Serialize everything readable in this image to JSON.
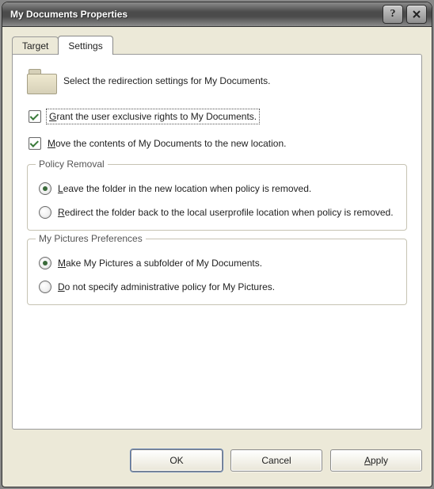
{
  "window": {
    "title": "My Documents Properties"
  },
  "tabs": [
    {
      "label": "Target",
      "active": false
    },
    {
      "label": "Settings",
      "active": true
    }
  ],
  "header": {
    "description": "Select the redirection settings for My Documents."
  },
  "checkboxes": {
    "exclusive_rights": {
      "label_pre": "G",
      "label_post": "rant the user exclusive rights to My Documents.",
      "checked": true,
      "focused": true
    },
    "move_contents": {
      "label_pre": "M",
      "label_post": "ove the contents of My Documents to the new location.",
      "checked": true,
      "focused": false
    }
  },
  "groups": {
    "policy_removal": {
      "legend": "Policy Removal",
      "options": {
        "leave": {
          "label_pre": "L",
          "label_post": "eave the folder in the new location when policy is removed.",
          "checked": true
        },
        "redirect": {
          "label_pre": "R",
          "label_post": "edirect the folder back to the local userprofile location when policy is removed.",
          "checked": false
        }
      }
    },
    "my_pictures": {
      "legend": "My Pictures Preferences",
      "options": {
        "subfolder": {
          "label_pre": "M",
          "label_post": "ake My Pictures a subfolder of My Documents.",
          "checked": true
        },
        "no_admin": {
          "label_pre": "D",
          "label_post": "o not specify administrative policy for My Pictures.",
          "checked": false
        }
      }
    }
  },
  "buttons": {
    "ok": "OK",
    "cancel": "Cancel",
    "apply_pre": "A",
    "apply_post": "pply"
  }
}
